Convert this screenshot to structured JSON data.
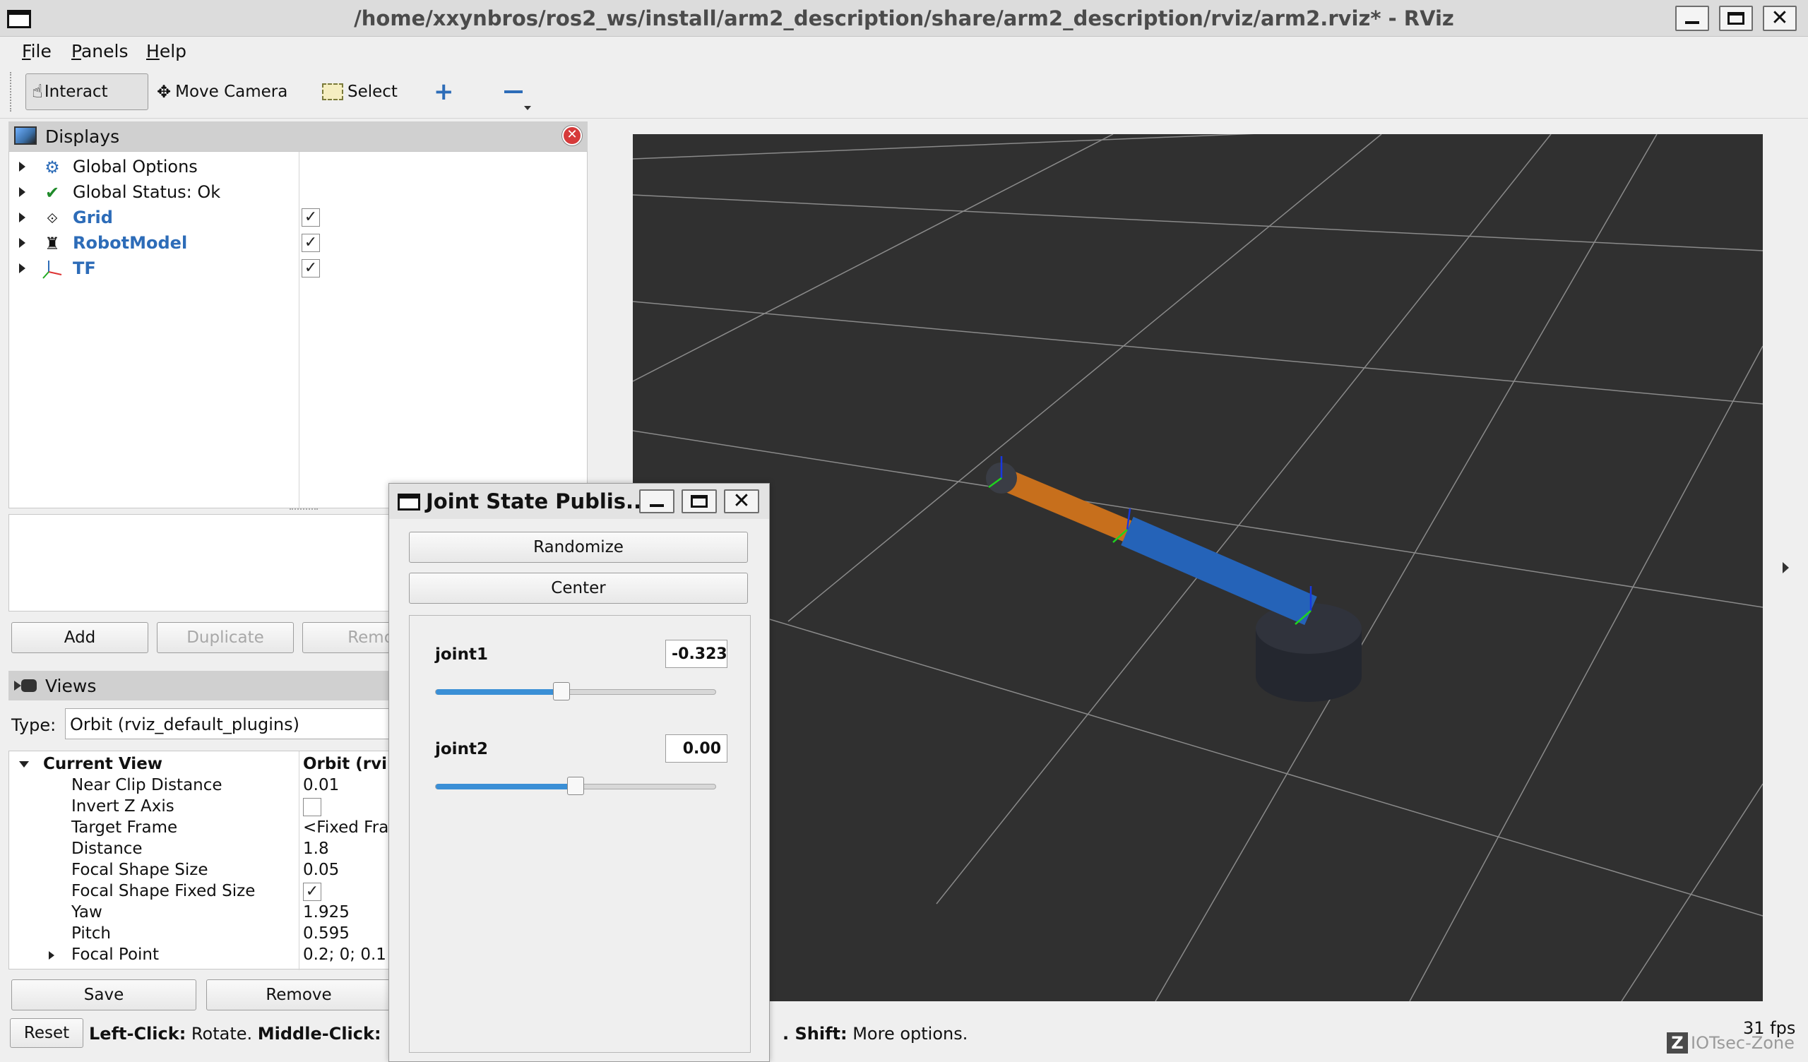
{
  "window": {
    "title": "/home/xxynbros/ros2_ws/install/arm2_description/share/arm2_description/rviz/arm2.rviz* - RViz"
  },
  "menu": [
    {
      "label": "File",
      "mnemonic": "F",
      "rest": "ile"
    },
    {
      "label": "Panels",
      "mnemonic": "P",
      "rest": "anels"
    },
    {
      "label": "Help",
      "mnemonic": "H",
      "rest": "elp"
    }
  ],
  "toolbar": {
    "interact": "Interact",
    "move_camera": "Move Camera",
    "select": "Select",
    "add_tool_icon": "plus-icon",
    "remove_tool_icon": "minus-icon"
  },
  "displays": {
    "title": "Displays",
    "items": [
      {
        "label": "Global Options",
        "icon": "gear-icon",
        "checked": null
      },
      {
        "label": "Global Status: Ok",
        "icon": "checkmark-icon",
        "checked": null
      },
      {
        "label": "Grid",
        "icon": "grid-icon",
        "checked": true
      },
      {
        "label": "RobotModel",
        "icon": "robot-icon",
        "checked": true
      },
      {
        "label": "TF",
        "icon": "axes-icon",
        "checked": true
      }
    ],
    "buttons": {
      "add": "Add",
      "duplicate": "Duplicate",
      "remove": "Remo"
    }
  },
  "views": {
    "title": "Views",
    "type_label": "Type:",
    "type_value": "Orbit (rviz_default_plugins)",
    "current_view_label": "Current View",
    "current_view_value": "Orbit (rvi",
    "properties": [
      {
        "key": "Near Clip Distance",
        "value": "0.01"
      },
      {
        "key": "Invert Z Axis",
        "value": "",
        "checkbox": false
      },
      {
        "key": "Target Frame",
        "value": "<Fixed Fra"
      },
      {
        "key": "Distance",
        "value": "1.8"
      },
      {
        "key": "Focal Shape Size",
        "value": "0.05"
      },
      {
        "key": "Focal Shape Fixed Size",
        "value": "",
        "checkbox": true
      },
      {
        "key": "Yaw",
        "value": "1.925"
      },
      {
        "key": "Pitch",
        "value": "0.595"
      },
      {
        "key": "Focal Point",
        "value": "0.2; 0; 0.1"
      }
    ],
    "buttons": {
      "save": "Save",
      "remove": "Remove"
    }
  },
  "status": {
    "reset": "Reset",
    "hint_left_bold1": "Left-Click:",
    "hint_left_text1": " Rotate. ",
    "hint_left_bold2": "Middle-Click:",
    "hint_right_bold": ". Shift:",
    "hint_right_text": " More options.",
    "fps": "31 fps",
    "watermark_logo": "Z",
    "watermark": "IOTsec-Zone"
  },
  "joint_state_publisher": {
    "title": "Joint State Publis...",
    "randomize": "Randomize",
    "center": "Center",
    "joints": [
      {
        "name": "joint1",
        "value": "-0.323",
        "fraction": 0.45
      },
      {
        "name": "joint2",
        "value": "0.00",
        "fraction": 0.5
      }
    ]
  },
  "colors": {
    "viewport_bg": "#303030",
    "link_orange": "#c76f1c",
    "link_blue": "#2563b8",
    "base_dark": "#272a33",
    "accent_blue": "#2d6cb8"
  }
}
